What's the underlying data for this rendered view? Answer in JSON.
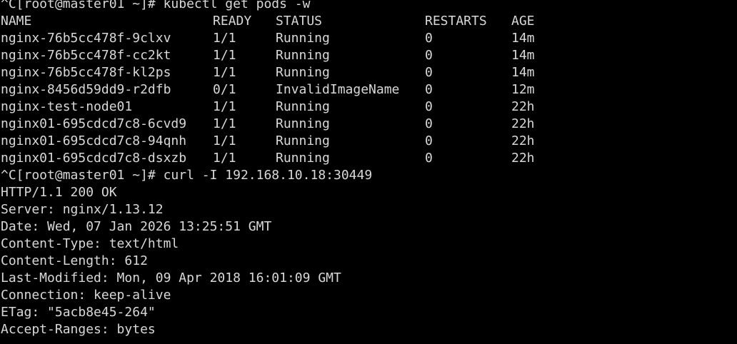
{
  "terminal": {
    "bg_color": "#000000",
    "fg_color": "#d8d8d8",
    "prompt_1": "^C[root@master01 ~]# kubectl get pods -w",
    "header": {
      "name": "NAME",
      "ready": "READY",
      "status": "STATUS",
      "restarts": "RESTARTS",
      "age": "AGE"
    },
    "pods": [
      {
        "name": "nginx-76b5cc478f-9clxv",
        "ready": "1/1",
        "status": "Running",
        "restarts": "0",
        "age": "14m"
      },
      {
        "name": "nginx-76b5cc478f-cc2kt",
        "ready": "1/1",
        "status": "Running",
        "restarts": "0",
        "age": "14m"
      },
      {
        "name": "nginx-76b5cc478f-kl2ps",
        "ready": "1/1",
        "status": "Running",
        "restarts": "0",
        "age": "14m"
      },
      {
        "name": "nginx-8456d59dd9-r2dfb",
        "ready": "0/1",
        "status": "InvalidImageName",
        "restarts": "0",
        "age": "12m"
      },
      {
        "name": "nginx-test-node01",
        "ready": "1/1",
        "status": "Running",
        "restarts": "0",
        "age": "22h"
      },
      {
        "name": "nginx01-695cdcd7c8-6cvd9",
        "ready": "1/1",
        "status": "Running",
        "restarts": "0",
        "age": "22h"
      },
      {
        "name": "nginx01-695cdcd7c8-94qnh",
        "ready": "1/1",
        "status": "Running",
        "restarts": "0",
        "age": "22h"
      },
      {
        "name": "nginx01-695cdcd7c8-dsxzb",
        "ready": "1/1",
        "status": "Running",
        "restarts": "0",
        "age": "22h"
      }
    ],
    "prompt_2": "^C[root@master01 ~]# curl -I 192.168.10.18:30449",
    "http_response": [
      "HTTP/1.1 200 OK",
      "Server: nginx/1.13.12",
      "Date: Wed, 07 Jan 2026 13:25:51 GMT",
      "Content-Type: text/html",
      "Content-Length: 612",
      "Last-Modified: Mon, 09 Apr 2018 16:01:09 GMT",
      "Connection: keep-alive",
      "ETag: \"5acb8e45-264\"",
      "Accept-Ranges: bytes"
    ]
  }
}
